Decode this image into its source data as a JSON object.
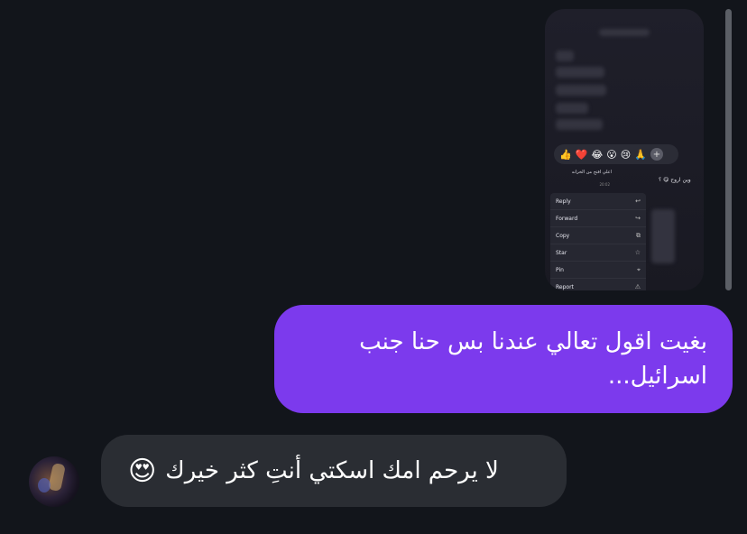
{
  "shared_media": {
    "reactions": [
      "👍",
      "❤️",
      "😂",
      "😮",
      "😢",
      "🙏"
    ],
    "quoted_text": "اعلي افتح من الخزانه",
    "quoted_time": "20:02",
    "side_text": "وين اروح 😋 ؟",
    "menu": [
      {
        "label": "Reply",
        "icon": "↩"
      },
      {
        "label": "Forward",
        "icon": "↪"
      },
      {
        "label": "Copy",
        "icon": "⧉"
      },
      {
        "label": "Star",
        "icon": "☆"
      },
      {
        "label": "Pin",
        "icon": "⌖"
      },
      {
        "label": "Report",
        "icon": "⚠"
      }
    ]
  },
  "messages": {
    "outgoing_text": "بغيت اقول تعالي عندنا بس حنا جنب اسرائيل...",
    "incoming_text": "لا يرحم امك اسكتي أنتِ كثر خيرك",
    "incoming_emoji": "😍"
  }
}
